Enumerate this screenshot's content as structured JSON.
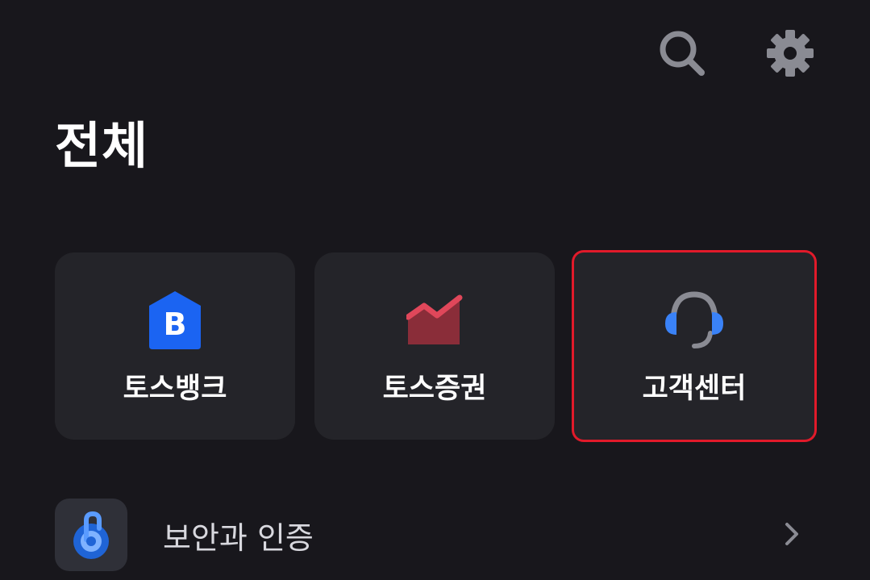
{
  "header": {
    "search_icon": "search-icon",
    "settings_icon": "gear-icon"
  },
  "page": {
    "title": "전체"
  },
  "tiles": [
    {
      "label": "토스뱅크",
      "icon": "bank-icon",
      "color": "#1b64f2"
    },
    {
      "label": "토스증권",
      "icon": "stock-chart-icon",
      "color": "#d9394b"
    },
    {
      "label": "고객센터",
      "icon": "headset-icon",
      "color": "#3a82f7",
      "selected": true
    }
  ],
  "rows": [
    {
      "label": "보안과 인증",
      "icon": "security-lock-icon",
      "color": "#3a82f7"
    }
  ],
  "colors": {
    "background": "#18171c",
    "tile": "#242429",
    "highlight": "#e11a2a"
  }
}
